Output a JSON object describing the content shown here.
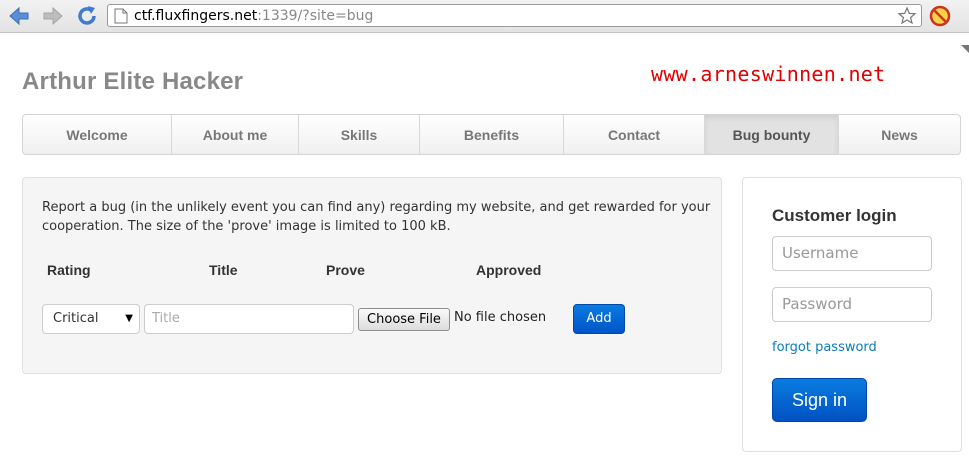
{
  "browser": {
    "url_host": "ctf.fluxfingers.net",
    "url_rest": ":1339/?site=bug",
    "icons": [
      "back-arrow-icon",
      "forward-arrow-icon",
      "reload-icon",
      "page-icon",
      "star-icon",
      "no-script-icon"
    ]
  },
  "site": {
    "title": "Arthur Elite Hacker",
    "watermark": "www.arneswinnen.net"
  },
  "nav": {
    "items": [
      "Welcome",
      "About me",
      "Skills",
      "Benefits",
      "Contact",
      "Bug bounty",
      "News"
    ],
    "active": "Bug bounty"
  },
  "bug_form": {
    "intro": "Report a bug (in the unlikely event you can find any) regarding my website, and get rewarded for your cooperation. The size of the 'prove' image is limited to 100 kB.",
    "headers": [
      "Rating",
      "Title",
      "Prove",
      "Approved"
    ],
    "rating_selected": "Critical",
    "title_placeholder": "Title",
    "file_button": "Choose File",
    "file_status": "No file chosen",
    "add_label": "Add"
  },
  "login": {
    "title": "Customer login",
    "username_placeholder": "Username",
    "password_placeholder": "Password",
    "forgot_link": "forgot password",
    "signin_label": "Sign in"
  },
  "colors": {
    "accent_blue": "#0a6fd8",
    "watermark_red": "#e00000",
    "title_gray": "#888888"
  }
}
